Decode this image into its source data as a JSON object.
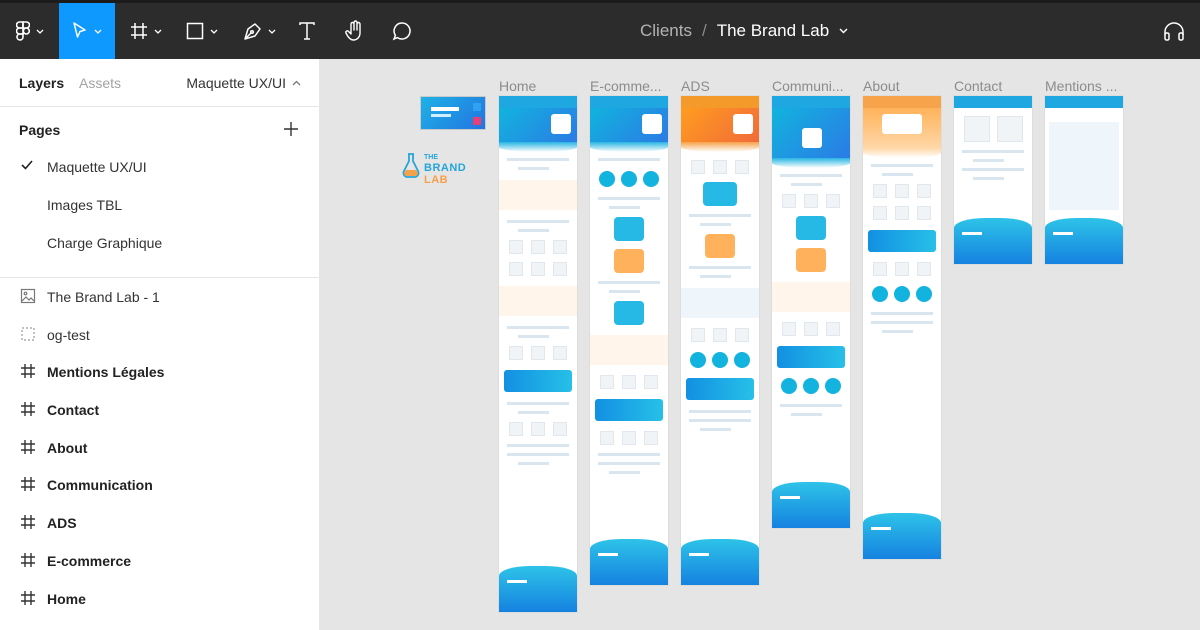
{
  "toolbar": {
    "tools": [
      {
        "name": "figma-menu",
        "icon": "figma-logo-icon"
      },
      {
        "name": "move-tool",
        "icon": "cursor-icon",
        "active": true
      },
      {
        "name": "frame-tool",
        "icon": "frame-hash-icon"
      },
      {
        "name": "shape-tool",
        "icon": "rectangle-icon"
      },
      {
        "name": "pen-tool",
        "icon": "pen-icon"
      },
      {
        "name": "text-tool",
        "icon": "text-icon"
      },
      {
        "name": "hand-tool",
        "icon": "hand-icon"
      },
      {
        "name": "comment-tool",
        "icon": "comment-icon"
      }
    ],
    "breadcrumb": "Clients",
    "separator": "/",
    "file_title": "The Brand Lab",
    "right_icon": "headphones-icon",
    "active_color": "#0d99ff"
  },
  "panel": {
    "tabs": {
      "layers": "Layers",
      "assets": "Assets"
    },
    "current_page": "Maquette UX/UI",
    "pages_header": "Pages",
    "pages": [
      {
        "label": "Maquette UX/UI",
        "selected": true
      },
      {
        "label": "Images TBL",
        "selected": false
      },
      {
        "label": "Charge Graphique",
        "selected": false
      }
    ],
    "layers": [
      {
        "label": "The Brand Lab - 1",
        "icon": "image-icon",
        "bold": false
      },
      {
        "label": "og-test",
        "icon": "dashed-frame-icon",
        "bold": false
      },
      {
        "label": "Mentions Légales",
        "icon": "frame-icon",
        "bold": true
      },
      {
        "label": "Contact",
        "icon": "frame-icon",
        "bold": true
      },
      {
        "label": "About",
        "icon": "frame-icon",
        "bold": true
      },
      {
        "label": "Communication",
        "icon": "frame-icon",
        "bold": true
      },
      {
        "label": "ADS",
        "icon": "frame-icon",
        "bold": true
      },
      {
        "label": "E-commerce",
        "icon": "frame-icon",
        "bold": true
      },
      {
        "label": "Home",
        "icon": "frame-icon",
        "bold": true
      }
    ]
  },
  "canvas": {
    "frames": [
      {
        "label": "Home"
      },
      {
        "label": "E-comme..."
      },
      {
        "label": "ADS"
      },
      {
        "label": "Communi..."
      },
      {
        "label": "About"
      },
      {
        "label": "Contact"
      },
      {
        "label": "Mentions ..."
      }
    ],
    "logo": {
      "the": "THE",
      "brand": "BRAND",
      "lab": "LAB"
    },
    "accent_blue": "#1ea7e1",
    "accent_orange": "#f5a04a"
  }
}
